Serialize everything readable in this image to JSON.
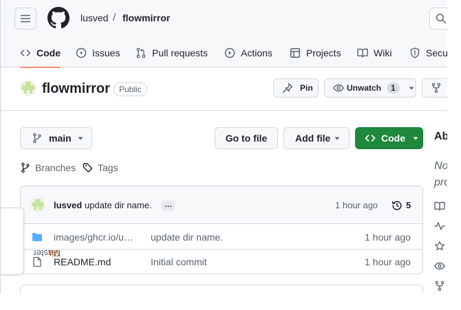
{
  "header": {
    "owner": "lusved",
    "separator": "/",
    "repo": "flowmirror"
  },
  "tabs": [
    {
      "label": "Code",
      "icon": "code-icon"
    },
    {
      "label": "Issues",
      "icon": "issue-icon"
    },
    {
      "label": "Pull requests",
      "icon": "pull-request-icon"
    },
    {
      "label": "Actions",
      "icon": "play-icon"
    },
    {
      "label": "Projects",
      "icon": "table-icon"
    },
    {
      "label": "Wiki",
      "icon": "book-icon"
    },
    {
      "label": "Secur",
      "icon": "shield-icon"
    }
  ],
  "repo_header": {
    "name": "flowmirror",
    "visibility": "Public",
    "pin_label": "Pin",
    "unwatch_label": "Unwatch",
    "watch_count": "1"
  },
  "toolbar": {
    "branch": "main",
    "go_to_file": "Go to file",
    "add_file": "Add file",
    "code": "Code",
    "branches_label": "Branches",
    "tags_label": "Tags"
  },
  "latest_commit": {
    "author": "lusved",
    "message": "update dir name.",
    "ellipsis": "…",
    "time": "1 hour ago",
    "commit_count": "5"
  },
  "files": [
    {
      "type": "folder",
      "name": "images/ghcr.io/u…",
      "message": "update dir name.",
      "time": "1 hour ago"
    },
    {
      "type": "file",
      "name": "README.md",
      "message": "Initial commit",
      "time": "1 hour ago"
    }
  ],
  "about": {
    "title": "Ab",
    "desc_line1": "No",
    "desc_line2": "pro"
  },
  "gitmaster": {
    "part1": "Git",
    "part2": "Master"
  },
  "colors": {
    "primary_button": "#1f883d",
    "active_tab_underline": "#fd8c73",
    "folder": "#54aeff",
    "gitmaster_accent": "#e36209"
  }
}
